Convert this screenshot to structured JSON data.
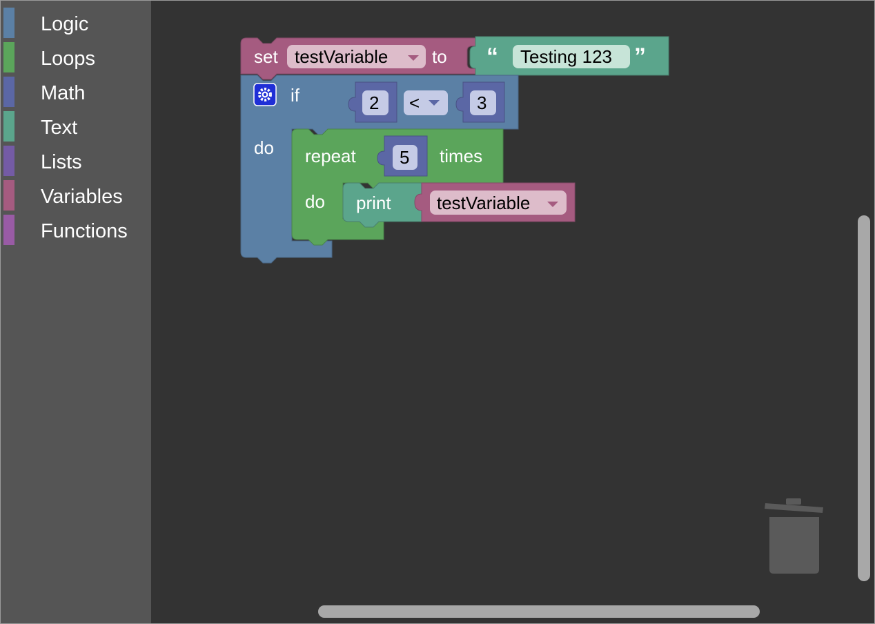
{
  "toolbox": {
    "categories": [
      {
        "label": "Logic",
        "color": "#5b80a5"
      },
      {
        "label": "Loops",
        "color": "#5ba55b"
      },
      {
        "label": "Math",
        "color": "#5b67a5"
      },
      {
        "label": "Text",
        "color": "#5ba58c"
      },
      {
        "label": "Lists",
        "color": "#745ba5"
      },
      {
        "label": "Variables",
        "color": "#a55b80"
      },
      {
        "label": "Functions",
        "color": "#995ba5"
      }
    ]
  },
  "blocks": {
    "set_block": {
      "keyword_set": "set",
      "variable": "testVariable",
      "keyword_to": "to",
      "color": "#a55b80"
    },
    "text_block": {
      "open_quote": "“",
      "value": "Testing 123",
      "close_quote": "”",
      "color": "#5ba58c"
    },
    "if_block": {
      "keyword_if": "if",
      "keyword_do": "do",
      "color": "#5b80a5",
      "compare": {
        "left": "2",
        "operator": "<",
        "right": "3",
        "color": "#5b67a5"
      }
    },
    "repeat_block": {
      "keyword_repeat": "repeat",
      "count": "5",
      "keyword_times": "times",
      "keyword_do": "do",
      "color": "#5ba55b"
    },
    "print_block": {
      "keyword_print": "print",
      "variable": "testVariable",
      "color": "#5ba58c"
    }
  },
  "icons": {
    "mutator": "gear-icon",
    "dropdown": "dropdown-arrow-icon",
    "trash": "trash-can-icon"
  }
}
